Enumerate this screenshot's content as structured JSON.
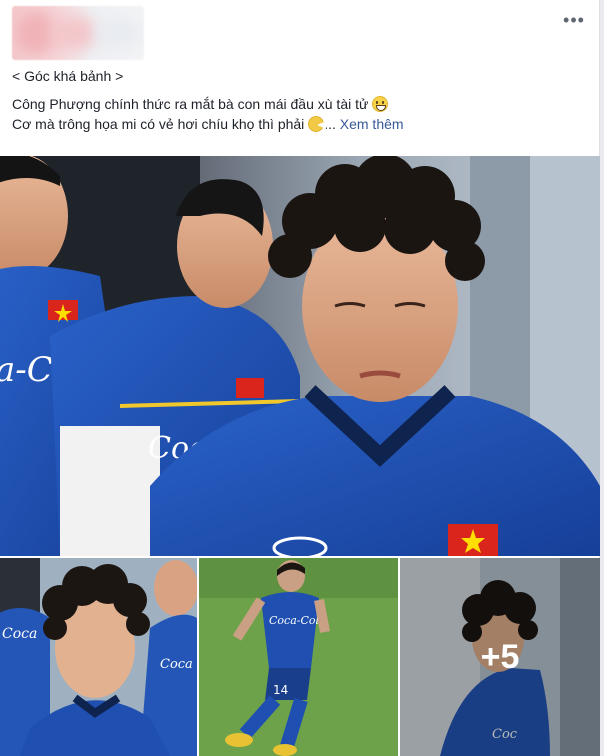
{
  "post": {
    "header": {
      "menu_icon": "ellipsis-icon",
      "menu_label": "•••"
    },
    "text": {
      "line1": "< Góc khá bảnh >",
      "line2": "Công Phượng chính thức ra mắt bà con mái đầu xù tài tử",
      "line2_emoji": "grinning-emoji",
      "line3": "Cơ mà trông họa mi có vẻ hơi chíu khọ thì phải",
      "line3_emoji": "pacman-emoji",
      "ellipsis": "...",
      "see_more": "Xem thêm"
    },
    "photos": {
      "main": {
        "shirt_text": "Coca-Cola"
      },
      "thumbs": [
        {
          "kind": "curly-hair-player-portrait"
        },
        {
          "kind": "player-running-field",
          "jersey_number": "14"
        },
        {
          "kind": "player-side-profile",
          "more_count": "+5"
        }
      ]
    }
  },
  "colors": {
    "link": "#385898",
    "jersey": "#1f4fb0",
    "flag_red": "#da251d",
    "flag_star": "#ffde00"
  }
}
